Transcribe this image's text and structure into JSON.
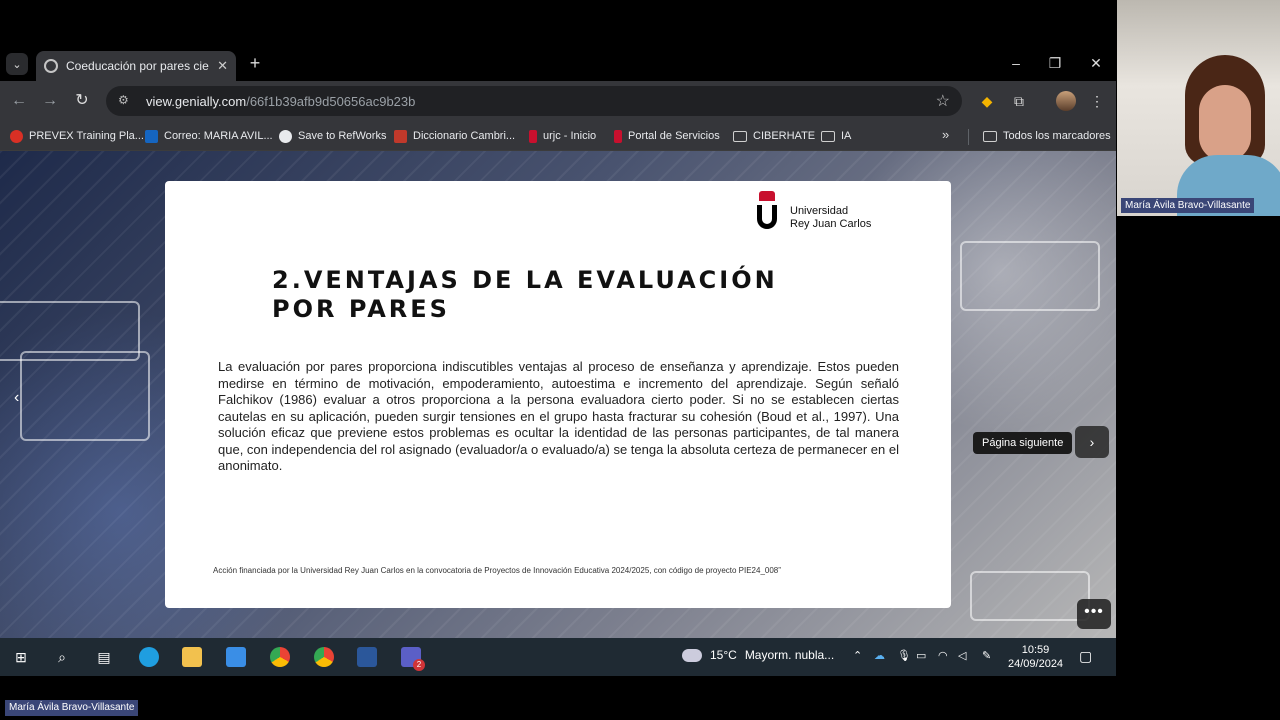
{
  "browser": {
    "tab_title": "Coeducación por pares ciegos",
    "url_domain": "view.genially.com",
    "url_path": "/66f1b39afb9d50656ac9b23b",
    "bookmarks": [
      {
        "label": "PREVEX Training Pla...",
        "icon": "red-circle-icon",
        "color": "#d93025"
      },
      {
        "label": "Correo: MARIA AVIL...",
        "icon": "outlook-icon",
        "color": "#1565c0"
      },
      {
        "label": "Save to RefWorks",
        "icon": "globe-icon",
        "color": "#e8eaed"
      },
      {
        "label": "Diccionario Cambri...",
        "icon": "cambridge-icon",
        "color": "#c0392b"
      },
      {
        "label": "urjc - Inicio",
        "icon": "urjc-icon",
        "color": "#c8102e"
      },
      {
        "label": "Portal de Servicios",
        "icon": "urjc-icon",
        "color": "#c8102e"
      },
      {
        "label": "CIBERHATE",
        "icon": "folder-icon"
      },
      {
        "label": "IA",
        "icon": "folder-icon"
      }
    ],
    "all_bookmarks": "Todos los marcadores"
  },
  "slide": {
    "university_line1": "Universidad",
    "university_line2": "Rey Juan Carlos",
    "title_line1": "2.VENTAJAS DE LA EVALUACIÓN",
    "title_line2": "POR PARES",
    "body": "La evaluación por pares proporciona indiscutibles ventajas al proceso de enseñanza y aprendizaje. Estos pueden medirse en término de motivación, empoderamiento, autoestima e incremento del aprendizaje. Según señaló Falchikov (1986) evaluar a otros proporciona a la persona evaluadora cierto poder. Si no se establecen ciertas cautelas en su aplicación, pueden surgir tensiones en el grupo hasta fracturar su cohesión (Boud et al., 1997). Una solución eficaz que previene estos problemas es ocultar la identidad de las personas participantes, de tal manera que, con independencia del rol asignado (evaluador/a o evaluado/a) se tenga la absoluta certeza de permanecer en el anonimato.",
    "footer": "Acción financiada por la Universidad Rey Juan Carlos en la convocatoria de Proyectos de Innovación Educativa 2024/2025, con código de proyecto PIE24_008”",
    "next_tooltip": "Página siguiente"
  },
  "taskbar": {
    "weather_temp": "15°C",
    "weather_text": "Mayorm. nubla...",
    "time": "10:59",
    "date": "24/09/2024",
    "teams_badge": "2"
  },
  "webcam": {
    "participant_name": "María Ávila Bravo-Villasante"
  }
}
